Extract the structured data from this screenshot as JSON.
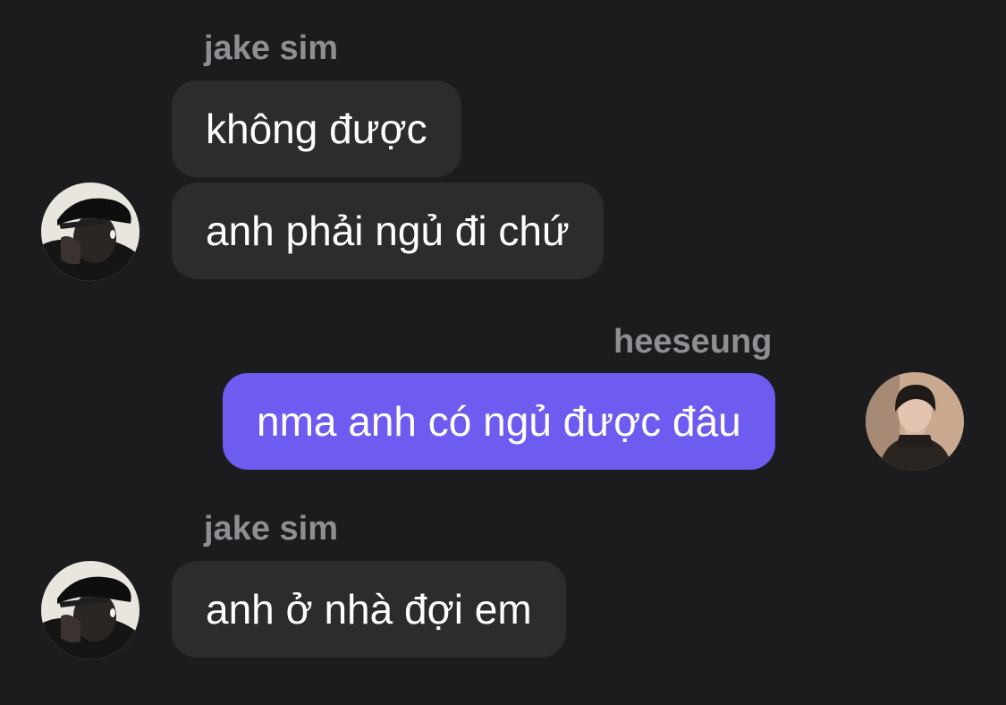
{
  "colors": {
    "background": "#1c1c1e",
    "incoming_bubble": "#2c2c2e",
    "outgoing_bubble": "#6e5bf0",
    "sender_name": "#8e8e93",
    "message_text": "#ffffff"
  },
  "groups": [
    {
      "sender": "jake sim",
      "direction": "incoming",
      "avatar": "jake-sim-avatar",
      "messages": [
        "không được",
        "anh phải ngủ đi chứ"
      ]
    },
    {
      "sender": "heeseung",
      "direction": "outgoing",
      "avatar": "heeseung-avatar",
      "messages": [
        "nma anh có ngủ được đâu"
      ]
    },
    {
      "sender": "jake sim",
      "direction": "incoming",
      "avatar": "jake-sim-avatar",
      "messages": [
        "anh ở nhà đợi em"
      ]
    }
  ]
}
